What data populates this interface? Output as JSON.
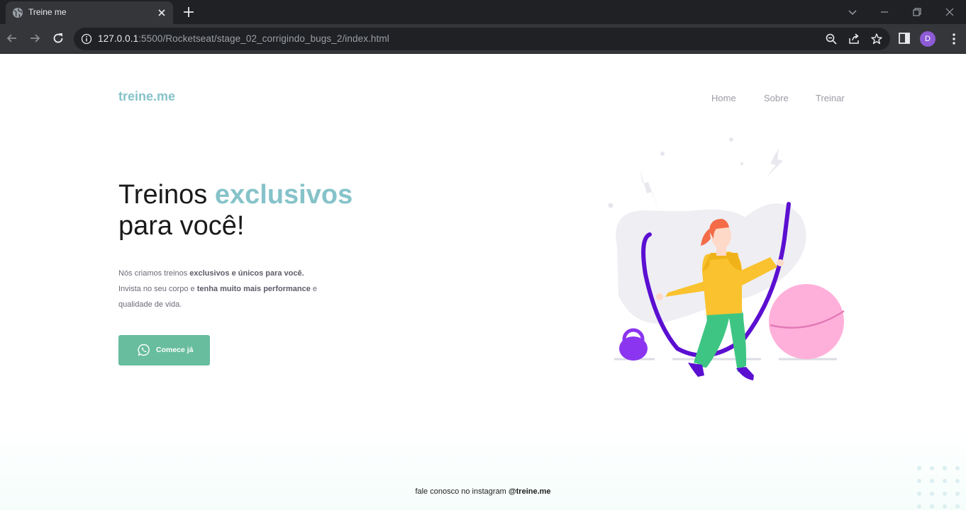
{
  "browser": {
    "tab_title": "Treine me",
    "url_host": "127.0.0.1",
    "url_rest": ":5500/Rocketseat/stage_02_corrigindo_bugs_2/index.html",
    "profile_initial": "D"
  },
  "header": {
    "logo": "treine.me",
    "nav": [
      "Home",
      "Sobre",
      "Treinar"
    ]
  },
  "hero": {
    "title_part1": "Treinos ",
    "title_accent": "exclusivos",
    "title_part2": "para você!",
    "line1_plain": "Nós criamos treinos ",
    "line1_bold": "exclusivos e únicos para você.",
    "line2_plain": "Invista no seu corpo e ",
    "line2_bold": "tenha muito mais performance",
    "line2_end": " e",
    "line3": "qualidade de vida.",
    "cta_label": "Comece já"
  },
  "footer": {
    "text": "fale conosco no instagram ",
    "handle": "@treine.me"
  },
  "colors": {
    "accent": "#86c3c9",
    "cta": "#68bd9f",
    "rope": "#5b0fd1",
    "shirt": "#f9c22e",
    "pants": "#3fc583",
    "ball": "#ffb0da"
  }
}
